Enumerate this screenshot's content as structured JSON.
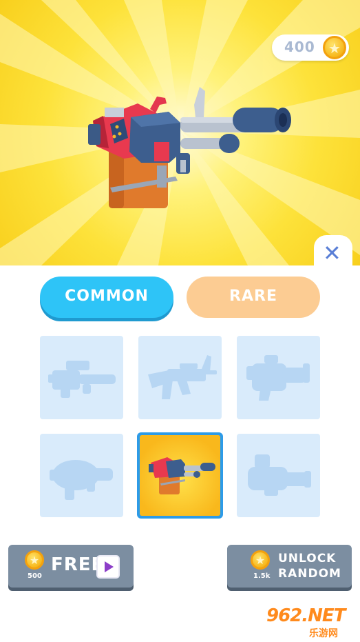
{
  "currency": {
    "amount": "400",
    "icon": "star-coin-icon"
  },
  "close": {
    "glyph": "✕"
  },
  "tabs": [
    {
      "label": "COMMON",
      "active": true
    },
    {
      "label": "RARE",
      "active": false
    }
  ],
  "grid": {
    "slots": [
      {
        "name": "locked-weapon-rifle",
        "state": "locked"
      },
      {
        "name": "locked-weapon-ak",
        "state": "locked"
      },
      {
        "name": "locked-weapon-blaster",
        "state": "locked"
      },
      {
        "name": "locked-weapon-grenade-launcher",
        "state": "locked"
      },
      {
        "name": "heavy-machine-gun",
        "state": "selected"
      },
      {
        "name": "locked-weapon-minigun",
        "state": "locked"
      }
    ]
  },
  "buttons": {
    "free": {
      "label": "FREE",
      "price": "500",
      "icon": "play-icon"
    },
    "unlock": {
      "label_line1": "UNLOCK",
      "label_line2": "RANDOM",
      "price": "1.5k"
    }
  },
  "watermark": {
    "text": "962.NET",
    "subtext": "乐游网"
  },
  "colors": {
    "accent": "#2ec4f7",
    "rare": "#fccc93",
    "button": "#7c8ea1",
    "locked": "#d9ebfb",
    "silhouette": "#b7d6f3"
  }
}
